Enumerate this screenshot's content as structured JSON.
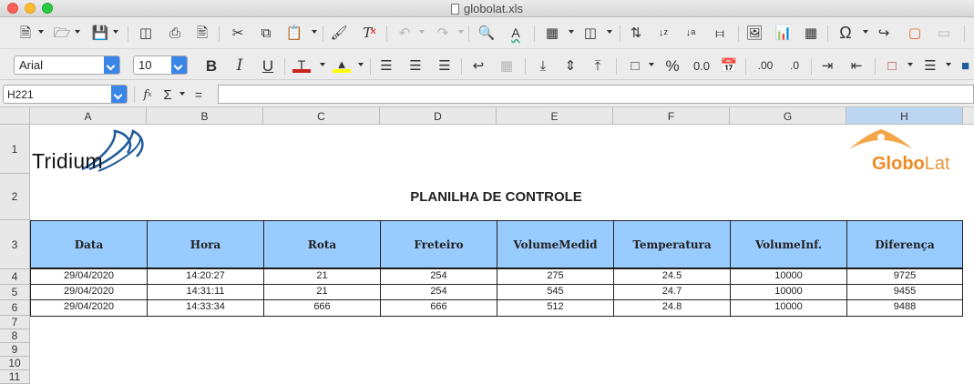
{
  "window": {
    "title": "globolat.xls"
  },
  "format_toolbar": {
    "font_name": "Arial",
    "font_size": "10"
  },
  "formula_bar": {
    "cell_ref": "H221",
    "formula": ""
  },
  "columns": [
    "A",
    "B",
    "C",
    "D",
    "E",
    "F",
    "G",
    "H"
  ],
  "selected_column": "H",
  "rows": [
    "1",
    "2",
    "3",
    "4",
    "5",
    "6",
    "7",
    "8",
    "9",
    "10",
    "11"
  ],
  "logos": {
    "left": "Tridium",
    "right_a": "Globo",
    "right_b": "Lat"
  },
  "sheet_title": "PLANILHA DE CONTROLE",
  "table": {
    "headers": [
      "Data",
      "Hora",
      "Rota",
      "Freteiro",
      "VolumeMedid",
      "Temperatura",
      "VolumeInf.",
      "Diferença"
    ],
    "rows": [
      [
        "29/04/2020",
        "14:20:27",
        "21",
        "254",
        "275",
        "24.5",
        "10000",
        "9725"
      ],
      [
        "29/04/2020",
        "14:31:11",
        "21",
        "254",
        "545",
        "24.7",
        "10000",
        "9455"
      ],
      [
        "29/04/2020",
        "14:33:34",
        "666",
        "666",
        "512",
        "24.8",
        "10000",
        "9488"
      ]
    ]
  },
  "colors": {
    "header_fill": "#99ccfe",
    "font_color": "#c9211e",
    "highlight": "#ffff00",
    "brand_orange": "#f08a22"
  }
}
